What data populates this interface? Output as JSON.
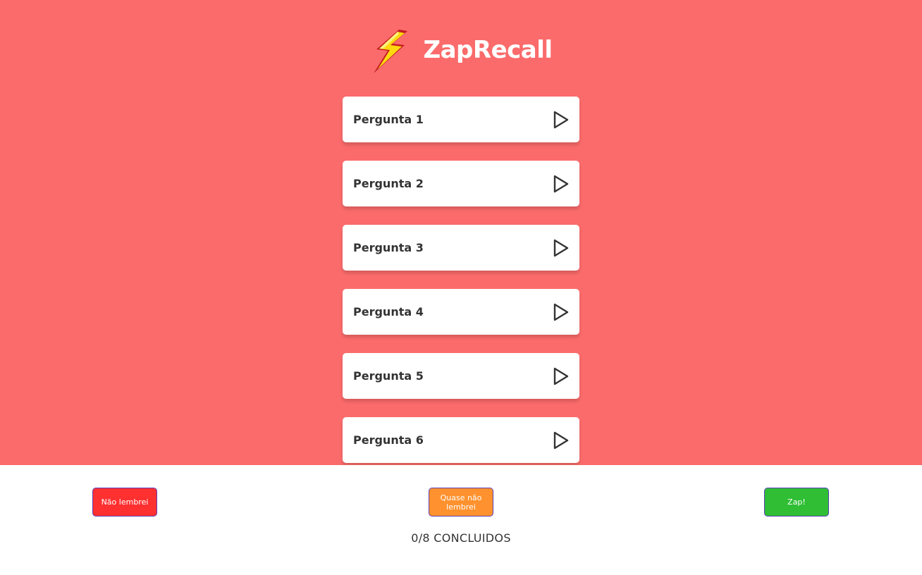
{
  "header": {
    "title": "ZapRecall",
    "logo_icon": "lightning-bolt-icon"
  },
  "colors": {
    "background": "#FB6B6B",
    "card": "#FFFFFF",
    "no_recall": "#FF3030",
    "almost_recall": "#FF922E",
    "zap": "#2FBE34",
    "button_border": "#5B3FB3"
  },
  "questions": [
    {
      "label": "Pergunta 1",
      "icon": "play-icon"
    },
    {
      "label": "Pergunta 2",
      "icon": "play-icon"
    },
    {
      "label": "Pergunta 3",
      "icon": "play-icon"
    },
    {
      "label": "Pergunta 4",
      "icon": "play-icon"
    },
    {
      "label": "Pergunta 5",
      "icon": "play-icon"
    },
    {
      "label": "Pergunta 6",
      "icon": "play-icon"
    }
  ],
  "footer": {
    "no_recall_label": "Não lembrei",
    "almost_recall_label": "Quase não lembrei",
    "zap_label": "Zap!",
    "progress_text": "0/8 CONCLUIDOS"
  }
}
